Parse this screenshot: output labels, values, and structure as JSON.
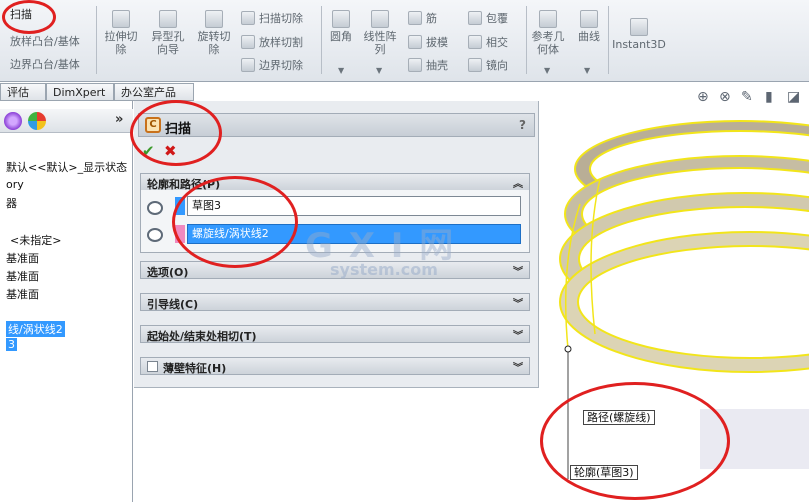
{
  "ribbon": {
    "sweep_label": "扫描",
    "loft_boss_label": "放样凸台/基体",
    "boundary_boss_label": "边界凸台/基体",
    "extruded_cut_label": "拉伸切除",
    "hole_wizard_label": "异型孔向导",
    "revolved_cut_label": "旋转切除",
    "swept_cut_label": "扫描切除",
    "lofted_cut_label": "放样切割",
    "boundary_cut_label": "边界切除",
    "fillet_label": "圆角",
    "linear_pattern_label": "线性阵列",
    "rib_label": "筋",
    "draft_label": "拔模",
    "shell_label": "抽壳",
    "wrap_label": "包覆",
    "intersect_label": "相交",
    "mirror_label": "镜向",
    "reference_geometry_label": "参考几何体",
    "curves_label": "曲线",
    "instant3d_label": "Instant3D"
  },
  "tabs": [
    {
      "label": "评估"
    },
    {
      "label": "DimXpert"
    },
    {
      "label": "办公室产品"
    }
  ],
  "tree": {
    "more": "»",
    "items": [
      {
        "label": "默认<<默认>_显示状态"
      },
      {
        "label": "ory"
      },
      {
        "label": "器"
      },
      {
        "label": "<未指定>"
      },
      {
        "label": "基准面"
      },
      {
        "label": "基准面"
      },
      {
        "label": "基准面"
      },
      {
        "label": "线/涡状线2"
      },
      {
        "label": "3"
      }
    ]
  },
  "property_manager": {
    "title": "扫描",
    "help": "?",
    "ok": "✔",
    "cancel": "✖",
    "profile_path": {
      "label": "轮廓和路径(P)",
      "profile_value": "草图3",
      "path_value": "螺旋线/涡状线2"
    },
    "groups": [
      {
        "label": "选项(O)"
      },
      {
        "label": "引导线(C)"
      },
      {
        "label": "起始处/结束处相切(T)"
      },
      {
        "label": "薄壁特征(H)"
      }
    ]
  },
  "graphics": {
    "path_callout": "路径(螺旋线)",
    "profile_callout": "轮廓(草图3)"
  },
  "watermark": {
    "logo": "G X I 网",
    "url": "system.com"
  },
  "colors": {
    "selection_blue": "#3399ff",
    "annotation_red": "#e02020",
    "helix_yellow": "#f2e51a",
    "helix_surface": "#c9bfa5",
    "ok_green": "#3b9a2b",
    "cancel_red": "#d01818"
  }
}
